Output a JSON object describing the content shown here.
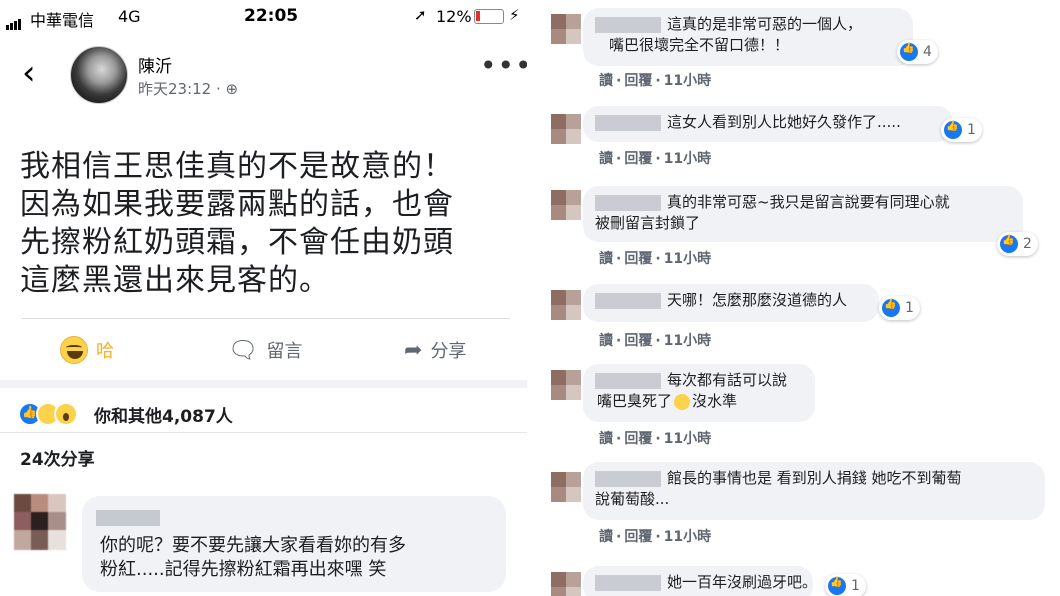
{
  "status_bar": {
    "carrier": "中華電信",
    "network": "4G",
    "time": "22:05",
    "battery": "12%",
    "location_icon": "location-arrow-icon",
    "battery_icon": "battery-low-icon",
    "charging_icon": "charging-bolt-icon"
  },
  "post": {
    "author": "陳沂",
    "timestamp": "昨天23:12",
    "privacy_icon": "globe-icon",
    "text_lines": [
      "我相信王思佳真的不是故意的！",
      "因為如果我要露兩點的話，也會",
      "先擦粉紅奶頭霜，不會任由奶頭",
      "這麼黑還出來見客的。"
    ],
    "actions": {
      "haha_label": "哈",
      "comment_label": "留言",
      "share_label": "分享"
    },
    "reactions_summary": "你和其他4,087人",
    "shares_count": "24次分享"
  },
  "bottom_comment": {
    "lines": [
      "你的呢？要不要先讓大家看看妳的有多",
      "粉紅.....記得先擦粉紅霜再出來嘿 笑"
    ]
  },
  "comments_meta": {
    "read": "讀",
    "separator": "·",
    "reply": "回覆",
    "time": "11小時"
  },
  "comments": [
    {
      "lines": [
        "這真的是非常可惡的一個人，",
        "嘴巴很壞完全不留口德！！"
      ],
      "likes": "4"
    },
    {
      "lines": [
        "這女人看到別人比她好久發作了....."
      ],
      "likes": "1"
    },
    {
      "lines": [
        "真的非常可惡~我只是留言說要有同理心就",
        "被刪留言封鎖了"
      ],
      "likes": "2"
    },
    {
      "lines": [
        "天哪！怎麼那麼沒道德的人"
      ],
      "likes": "1"
    },
    {
      "lines": [
        "每次都有話可以說",
        "嘴巴臭死了",
        "沒水準"
      ],
      "likes": ""
    },
    {
      "lines": [
        "館長的事情也是 看到別人捐錢 她吃不到葡萄",
        "說葡萄酸..."
      ],
      "likes": ""
    },
    {
      "lines": [
        "她一百年沒刷過牙吧。"
      ],
      "likes": "1"
    }
  ]
}
